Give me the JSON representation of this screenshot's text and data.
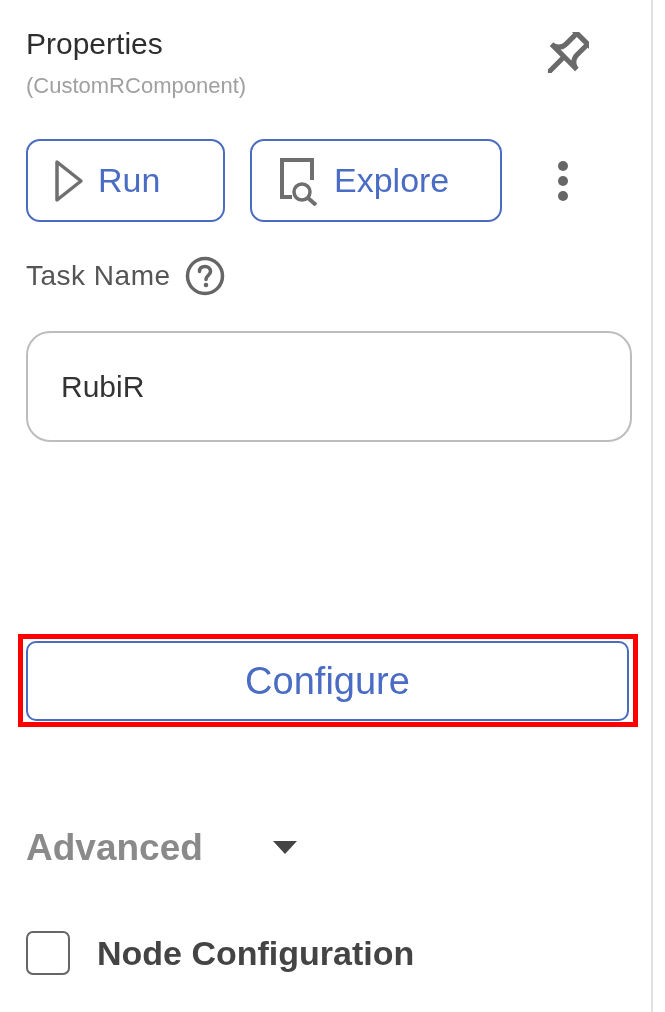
{
  "header": {
    "title": "Properties",
    "subtitle": "(CustomRComponent)"
  },
  "actions": [
    {
      "kind": "run",
      "label": "Run"
    },
    {
      "kind": "explore",
      "label": "Explore"
    }
  ],
  "task_name": {
    "label": "Task Name",
    "value": "RubiR"
  },
  "configure_button": {
    "label": "Configure",
    "highlighted": true
  },
  "advanced": {
    "label": "Advanced",
    "expanded": false
  },
  "options": [
    {
      "label": "Node Configuration",
      "checked": false
    }
  ]
}
